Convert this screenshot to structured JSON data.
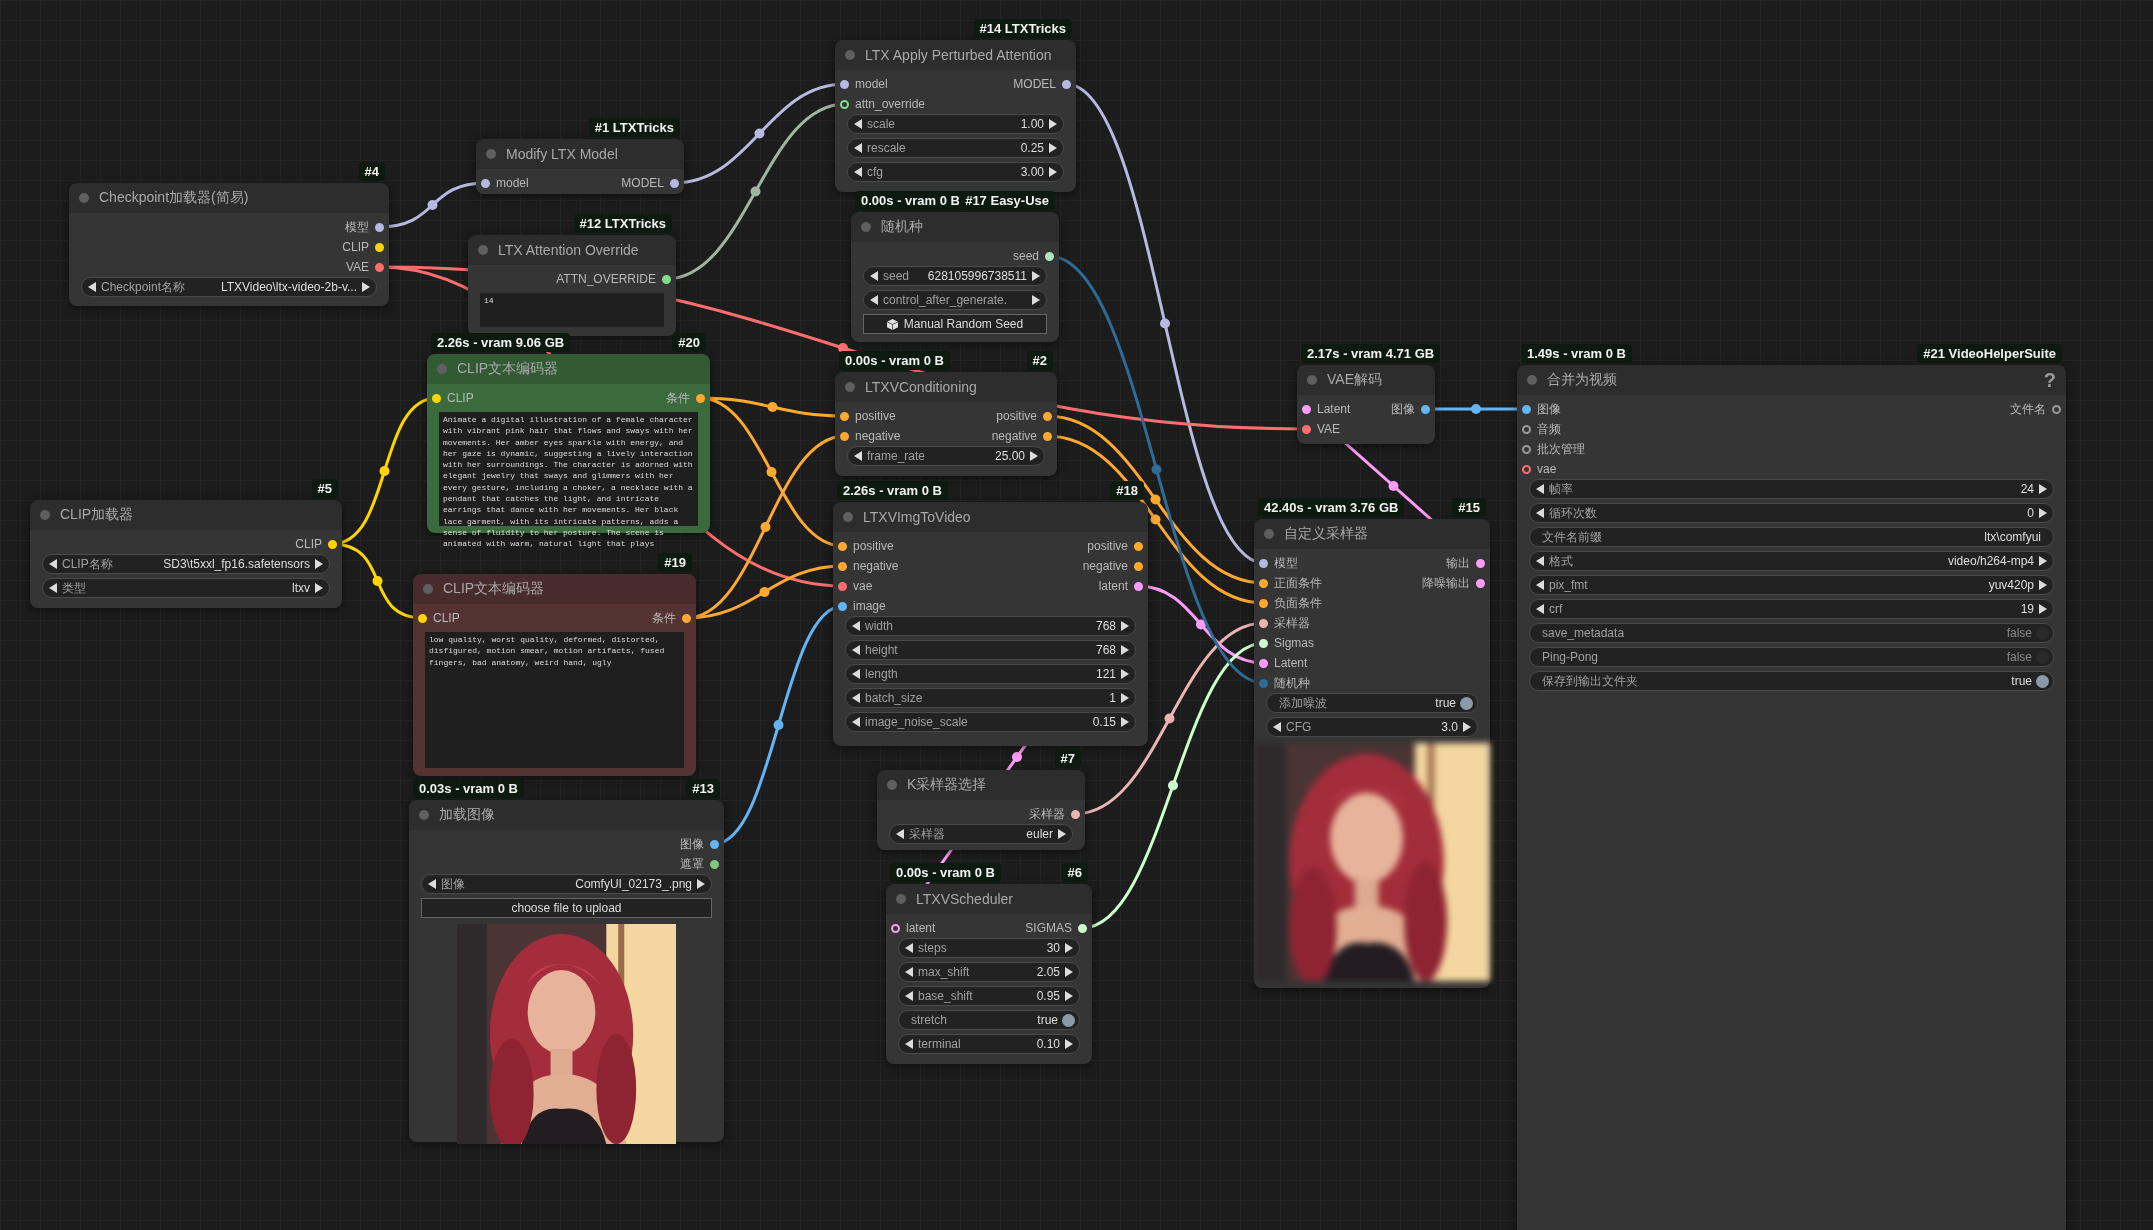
{
  "nodes": [
    {
      "badge": "#4",
      "title": "Checkpoint加载器(简易)",
      "color": "#353535",
      "outputs": [
        {
          "label": "模型",
          "color": "#b8b8e0",
          "optional": false
        },
        {
          "label": "CLIP",
          "color": "#ffd500",
          "optional": false
        },
        {
          "label": "VAE",
          "color": "#ff6e6e",
          "optional": false
        }
      ],
      "widgets": [
        {
          "kind": "value",
          "label": "Checkpoint名称",
          "value": "LTXVideo\\ltx-video-2b-v..."
        }
      ]
    },
    {
      "badge": "#1 LTXTricks",
      "title": "Modify LTX Model",
      "color": "#353535",
      "inputs": [
        {
          "label": "model",
          "color": "#b8b8e0",
          "optional": false
        }
      ],
      "outputs": [
        {
          "label": "MODEL",
          "color": "#b8b8e0",
          "optional": false
        }
      ]
    },
    {
      "badge": "#12 LTXTricks",
      "title": "LTX Attention Override",
      "color": "#353535",
      "outputs": [
        {
          "label": "ATTN_OVERRIDE",
          "color": "#7ee08a",
          "optional": false
        }
      ],
      "widgets": [
        {
          "kind": "textarea",
          "value": "14"
        }
      ]
    },
    {
      "badge": "#14 LTXTricks",
      "title": "LTX Apply Perturbed Attention",
      "color": "#353535",
      "inputs": [
        {
          "label": "model",
          "color": "#b8b8e0",
          "optional": false
        },
        {
          "label": "attn_override",
          "color": "#7ee08a",
          "optional": true
        }
      ],
      "outputs": [
        {
          "label": "MODEL",
          "color": "#b8b8e0",
          "optional": false
        }
      ],
      "widgets": [
        {
          "kind": "value",
          "label": "scale",
          "value": "1.00"
        },
        {
          "kind": "value",
          "label": "rescale",
          "value": "0.25"
        },
        {
          "kind": "value",
          "label": "cfg",
          "value": "3.00"
        }
      ]
    },
    {
      "stats": "0.00s - vram 0 B",
      "badge": "#17 Easy-Use",
      "title": "随机种",
      "color": "#353535",
      "outputs": [
        {
          "label": "seed",
          "color": "#a9e5c0",
          "optional": false
        }
      ],
      "widgets": [
        {
          "kind": "value",
          "label": "seed",
          "value": "628105996738511"
        },
        {
          "kind": "value",
          "label": "control_after_generate."
        },
        {
          "kind": "dice_button",
          "label": "Manual Random Seed"
        }
      ]
    },
    {
      "stats": "2.26s - vram 9.06 GB",
      "badge": "#20",
      "title": "CLIP文本编码器",
      "color": "#3b6b3d",
      "inputs": [
        {
          "label": "CLIP",
          "color": "#ffd500",
          "optional": false
        }
      ],
      "outputs": [
        {
          "label": "条件",
          "color": "#ffa931",
          "optional": false
        }
      ],
      "widgets": [
        {
          "kind": "textarea",
          "value": "Animate a digital illustration of a female character\nwith vibrant pink hair that flows and sways with her\nmovements. Her amber eyes sparkle with energy, and\nher gaze is dynamic, suggesting a lively interaction\nwith her surroundings. The character is adorned with\nelegant jewelry that sways and glimmers with her\nevery gesture, including a choker, a necklace with a\npendant that catches the light, and intricate\nearrings that dance with her movements. Her black\nlace garment, with its intricate patterns, adds a\nsense of fluidity to her posture. The scene is\nanimated with warm, natural light that plays"
        }
      ]
    },
    {
      "badge": "#5",
      "title": "CLIP加载器",
      "color": "#353535",
      "outputs": [
        {
          "label": "CLIP",
          "color": "#ffd500",
          "optional": false
        }
      ],
      "widgets": [
        {
          "kind": "value",
          "label": "CLIP名称",
          "value": "SD3\\t5xxl_fp16.safetensors"
        },
        {
          "kind": "value",
          "label": "类型",
          "value": "ltxv"
        }
      ]
    },
    {
      "badge": "#19",
      "title": "CLIP文本编码器",
      "color": "#553333",
      "inputs": [
        {
          "label": "CLIP",
          "color": "#ffd500",
          "optional": false
        }
      ],
      "outputs": [
        {
          "label": "条件",
          "color": "#ffa931",
          "optional": false
        }
      ],
      "widgets": [
        {
          "kind": "textarea",
          "value": "low quality, worst quality, deformed, distorted,\ndisfigured, motion smear, motion artifacts, fused\nfingers, bad anatomy, weird hand, ugly"
        }
      ]
    },
    {
      "stats": "0.03s - vram 0 B",
      "badge": "#13",
      "title": "加载图像",
      "color": "#353535",
      "outputs": [
        {
          "label": "图像",
          "color": "#64b5f6",
          "optional": false
        },
        {
          "label": "遮罩",
          "color": "#81c784",
          "optional": false
        }
      ],
      "widgets": [
        {
          "kind": "value",
          "label": "图像",
          "value": "ComfyUI_02173_.png"
        },
        {
          "kind": "button",
          "label": "choose file to upload"
        },
        {
          "kind": "picture"
        }
      ]
    },
    {
      "stats": "0.00s - vram 0 B",
      "badge": "#2",
      "title": "LTXVConditioning",
      "color": "#353535",
      "inputs": [
        {
          "label": "positive",
          "color": "#ffa931",
          "optional": false
        },
        {
          "label": "negative",
          "color": "#ffa931",
          "optional": false
        }
      ],
      "outputs": [
        {
          "label": "positive",
          "color": "#ffa931",
          "optional": false
        },
        {
          "label": "negative",
          "color": "#ffa931",
          "optional": false
        }
      ],
      "widgets": [
        {
          "kind": "value",
          "label": "frame_rate",
          "value": "25.00"
        }
      ]
    },
    {
      "stats": "2.26s - vram 0 B",
      "badge": "#18",
      "title": "LTXVImgToVideo",
      "color": "#353535",
      "inputs": [
        {
          "label": "positive",
          "color": "#ffa931",
          "optional": false
        },
        {
          "label": "negative",
          "color": "#ffa931",
          "optional": false
        },
        {
          "label": "vae",
          "color": "#ff6e6e",
          "optional": false
        },
        {
          "label": "image",
          "color": "#64b5f6",
          "optional": false
        }
      ],
      "outputs": [
        {
          "label": "positive",
          "color": "#ffa931",
          "optional": false
        },
        {
          "label": "negative",
          "color": "#ffa931",
          "optional": false
        },
        {
          "label": "latent",
          "color": "#ff9cf9",
          "optional": false
        }
      ],
      "widgets": [
        {
          "kind": "value",
          "label": "width",
          "value": "768"
        },
        {
          "kind": "value",
          "label": "height",
          "value": "768"
        },
        {
          "kind": "value",
          "label": "length",
          "value": "121"
        },
        {
          "kind": "value",
          "label": "batch_size",
          "value": "1"
        },
        {
          "kind": "value",
          "label": "image_noise_scale",
          "value": "0.15"
        }
      ]
    },
    {
      "badge": "#7",
      "title": "K采样器选择",
      "color": "#353535",
      "outputs": [
        {
          "label": "采样器",
          "color": "#ecb4b4",
          "optional": false
        }
      ],
      "widgets": [
        {
          "kind": "value",
          "label": "采样器",
          "value": "euler"
        }
      ]
    },
    {
      "stats": "0.00s - vram 0 B",
      "badge": "#6",
      "title": "LTXVScheduler",
      "color": "#353535",
      "inputs": [
        {
          "label": "latent",
          "color": "#ff9cf9",
          "optional": true
        }
      ],
      "outputs": [
        {
          "label": "SIGMAS",
          "color": "#cdffcd",
          "optional": false
        }
      ],
      "widgets": [
        {
          "kind": "value",
          "label": "steps",
          "value": "30"
        },
        {
          "kind": "value",
          "label": "max_shift",
          "value": "2.05"
        },
        {
          "kind": "value",
          "label": "base_shift",
          "value": "0.95"
        },
        {
          "kind": "toggle",
          "label": "stretch",
          "value": "true",
          "on": true
        },
        {
          "kind": "value",
          "label": "terminal",
          "value": "0.10"
        }
      ]
    },
    {
      "stats": "2.17s - vram 4.71 GB",
      "title": "VAE解码",
      "color": "#353535",
      "inputs": [
        {
          "label": "Latent",
          "color": "#ff9cf9",
          "optional": false
        },
        {
          "label": "VAE",
          "color": "#ff6e6e",
          "optional": false
        }
      ],
      "outputs": [
        {
          "label": "图像",
          "color": "#64b5f6",
          "optional": false
        }
      ]
    },
    {
      "stats": "42.40s - vram 3.76 GB",
      "badge": "#15",
      "title": "自定义采样器",
      "color": "#353535",
      "inputs": [
        {
          "label": "模型",
          "color": "#b8b8e0",
          "optional": false
        },
        {
          "label": "正面条件",
          "color": "#ffa931",
          "optional": false
        },
        {
          "label": "负面条件",
          "color": "#ffa931",
          "optional": false
        },
        {
          "label": "采样器",
          "color": "#ecb4b4",
          "optional": false
        },
        {
          "label": "Sigmas",
          "color": "#cdffcd",
          "optional": false
        },
        {
          "label": "Latent",
          "color": "#ff9cf9",
          "optional": false
        },
        {
          "label": "随机种",
          "color": "#2d6c96",
          "optional": false
        }
      ],
      "outputs": [
        {
          "label": "输出",
          "color": "#ff9cf9",
          "optional": false
        },
        {
          "label": "降噪输出",
          "color": "#ff9cf9",
          "optional": false
        }
      ],
      "widgets": [
        {
          "kind": "toggle",
          "label": "添加噪波",
          "value": "true",
          "on": true
        },
        {
          "kind": "value",
          "label": "CFG",
          "value": "3.0"
        },
        {
          "kind": "preview"
        }
      ]
    },
    {
      "stats": "1.49s - vram 0 B",
      "badge": "#21 VideoHelperSuite",
      "title": "合并为视频",
      "help": "?",
      "color": "#353535",
      "inputs": [
        {
          "label": "图像",
          "color": "#64b5f6",
          "optional": false
        },
        {
          "label": "音频",
          "color": "#9a9a9a",
          "optional": true
        },
        {
          "label": "批次管理",
          "color": "#9a9a9a",
          "optional": true
        },
        {
          "label": "vae",
          "color": "#ff6e6e",
          "optional": true
        }
      ],
      "outputs": [
        {
          "label": "文件名",
          "color": "#9a9a9a",
          "optional": true
        }
      ],
      "widgets": [
        {
          "kind": "value",
          "label": "帧率",
          "value": "24"
        },
        {
          "kind": "value",
          "label": "循环次数",
          "value": "0"
        },
        {
          "kind": "text",
          "label": "文件名前缀",
          "value": "ltx\\comfyui"
        },
        {
          "kind": "value",
          "label": "格式",
          "value": "video/h264-mp4"
        },
        {
          "kind": "value",
          "label": "pix_fmt",
          "value": "yuv420p"
        },
        {
          "kind": "value",
          "label": "crf",
          "value": "19"
        },
        {
          "kind": "toggle",
          "label": "save_metadata",
          "value": "false",
          "on": false
        },
        {
          "kind": "toggle",
          "label": "Ping-Pong",
          "value": "false",
          "on": false
        },
        {
          "kind": "toggle",
          "label": "保存到输出文件夹",
          "value": "true",
          "on": true
        }
      ]
    }
  ]
}
